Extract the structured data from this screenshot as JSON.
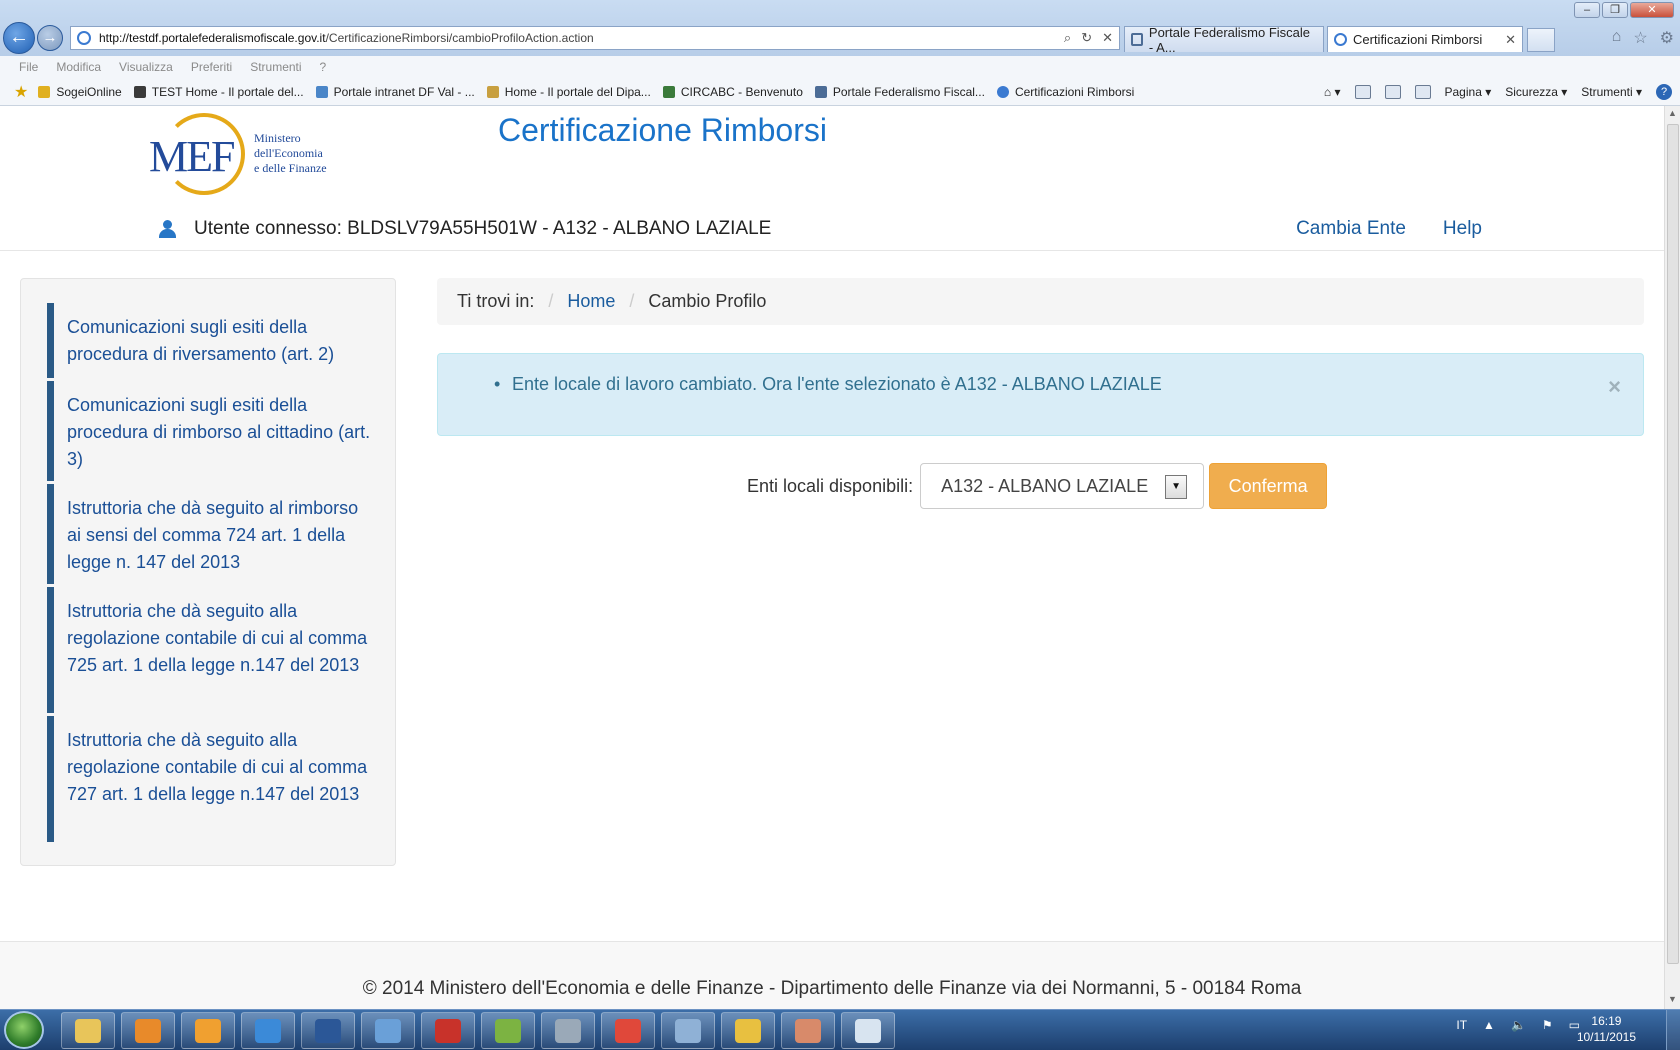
{
  "browser": {
    "url_host": "http://testdf.portalefederalismofiscale.gov.it",
    "url_path": "/CertificazioneRimborsi/cambioProfiloAction.action",
    "tabs": [
      {
        "label": "Portale Federalismo Fiscale - A..."
      },
      {
        "label": "Certificazioni Rimborsi"
      }
    ],
    "menu": [
      "File",
      "Modifica",
      "Visualizza",
      "Preferiti",
      "Strumenti",
      "?"
    ],
    "favorites": [
      {
        "label": "SogeiOnline",
        "color": "#e0b020"
      },
      {
        "label": "TEST Home - Il portale del...",
        "color": "#3a3a3a"
      },
      {
        "label": "Portale intranet DF Val  - ...",
        "color": "#4a86c8"
      },
      {
        "label": "Home - Il portale del Dipa...",
        "color": "#c8a040"
      },
      {
        "label": "CIRCABC - Benvenuto",
        "color": "#3a7a3a"
      },
      {
        "label": "Portale Federalismo Fiscal...",
        "color": "#4c6c96"
      },
      {
        "label": "Certificazioni Rimborsi",
        "color": "#3b7ad1"
      }
    ],
    "commands": {
      "page": "Pagina",
      "security": "Sicurezza",
      "tools": "Strumenti",
      "help": "?"
    }
  },
  "header": {
    "logo": {
      "mark": "MEF",
      "line1": "Ministero",
      "line2": "dell'Economia",
      "line3": "e delle Finanze"
    },
    "title": "Certificazione Rimborsi",
    "user_text": "Utente connesso: BLDSLV79A55H501W - A132 - ALBANO LAZIALE",
    "links": {
      "change_entity": "Cambia Ente",
      "help": "Help"
    }
  },
  "sidebar": {
    "items": [
      {
        "label": "Comunicazioni sugli esiti della procedura di riversamento (art. 2)"
      },
      {
        "label": "Comunicazioni sugli esiti della procedura di rimborso al cittadino (art. 3)"
      },
      {
        "label": "Istruttoria che dà seguito al rimborso ai sensi del comma 724 art. 1 della legge n. 147 del 2013"
      },
      {
        "label": "Istruttoria che dà seguito alla regolazione contabile di cui al comma 725 art. 1 della legge n.147 del 2013"
      },
      {
        "label": "Istruttoria che dà seguito alla regolazione contabile di cui al comma 727 art. 1 della legge n.147 del 2013"
      }
    ]
  },
  "breadcrumb": {
    "prefix": "Ti trovi in:",
    "home": "Home",
    "current": "Cambio Profilo"
  },
  "alert": {
    "message": "Ente locale di lavoro cambiato. Ora l'ente selezionato è A132 - ALBANO LAZIALE",
    "close": "×"
  },
  "form": {
    "label": "Enti locali disponibili:",
    "selected": "A132 - ALBANO LAZIALE",
    "confirm": "Conferma"
  },
  "footer": {
    "text": "© 2014 Ministero dell'Economia e delle Finanze - Dipartimento delle Finanze via dei Normanni, 5 - 00184 Roma"
  },
  "taskbar": {
    "language": "IT",
    "time": "16:19",
    "date": "10/11/2015",
    "apps": [
      {
        "name": "explorer",
        "color": "#e8c55a"
      },
      {
        "name": "media-player",
        "color": "#e88a2a"
      },
      {
        "name": "outlook",
        "color": "#f0a030"
      },
      {
        "name": "internet-explorer",
        "color": "#3b8ad8"
      },
      {
        "name": "word",
        "color": "#2b5797"
      },
      {
        "name": "sametime",
        "color": "#6aa0d8"
      },
      {
        "name": "sc-app",
        "color": "#c8322a"
      },
      {
        "name": "editor",
        "color": "#7cb342"
      },
      {
        "name": "database",
        "color": "#9aa9b8"
      },
      {
        "name": "chrome",
        "color": "#e0483a"
      },
      {
        "name": "search-app",
        "color": "#8fb1d6"
      },
      {
        "name": "security-center",
        "color": "#e8c040"
      },
      {
        "name": "paint",
        "color": "#d88a6a"
      },
      {
        "name": "snipping-tool",
        "color": "#d8e4f0"
      }
    ]
  }
}
